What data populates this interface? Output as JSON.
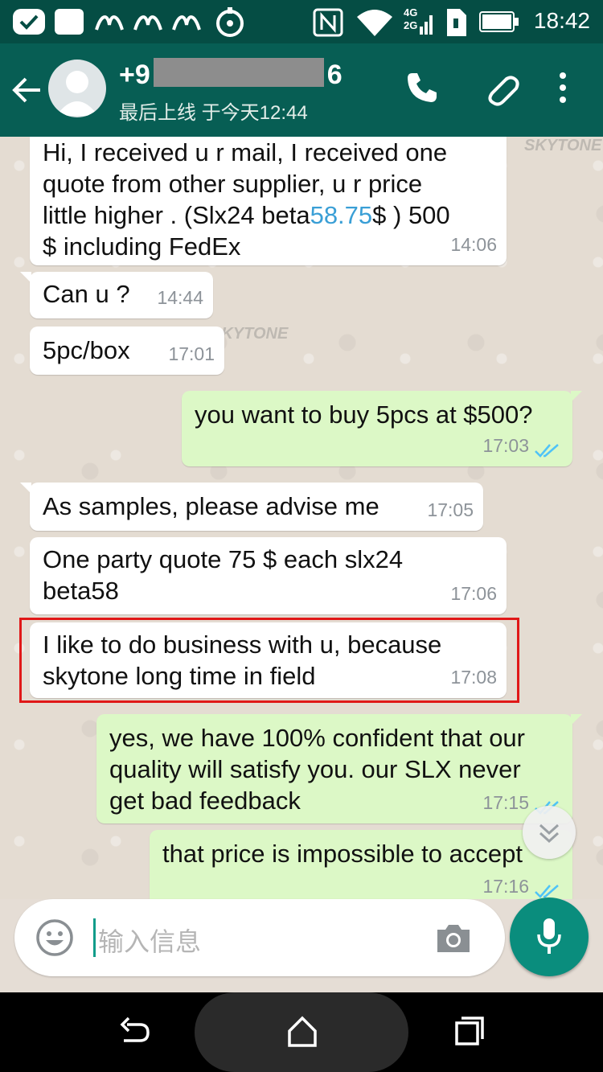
{
  "status_bar": {
    "time": "18:42",
    "network_labels": [
      "4G",
      "2G"
    ],
    "icons": [
      "check-notification-icon",
      "square-notification-icon",
      "wave-notification-icon",
      "wave-notification-icon",
      "wave-notification-icon",
      "sync-icon",
      "nfc-icon",
      "wifi-icon",
      "signal-icon",
      "sim-icon",
      "battery-icon"
    ]
  },
  "header": {
    "contact_prefix": "+9",
    "contact_suffix": "6",
    "last_seen": "最后上线 于今天12:44",
    "icons": [
      "back-arrow-icon",
      "avatar",
      "phone-icon",
      "paperclip-icon",
      "more-vert-icon"
    ]
  },
  "messages": [
    {
      "dir": "in",
      "text_a": "Hi, I received u r mail,  I received one\nquote from other supplier, u r price\nlittle higher . (Slx24 beta",
      "link": "58.75",
      "text_b": "$ ) 500\n$ including FedEx",
      "time": "14:06"
    },
    {
      "dir": "in",
      "text": "Can u ?",
      "time": "14:44"
    },
    {
      "dir": "in",
      "text": "5pc/box",
      "time": "17:01"
    },
    {
      "dir": "out",
      "text": "you want to buy 5pcs at $500?",
      "time": "17:03"
    },
    {
      "dir": "in",
      "text": "As samples, please advise me",
      "time": "17:05"
    },
    {
      "dir": "in",
      "text": "One party quote 75 $ each slx24\nbeta58",
      "time": "17:06"
    },
    {
      "dir": "in",
      "text": "I like to do business with u, because\nskytone long time in field",
      "time": "17:08"
    },
    {
      "dir": "out",
      "text": "yes, we have 100% confident that our\nquality will satisfy you. our SLX never\nget bad feedback",
      "time": "17:15"
    },
    {
      "dir": "out",
      "text": "that price is impossible to accept",
      "time": "17:16"
    }
  ],
  "watermark": "SKYTONE",
  "input": {
    "placeholder": "输入信息"
  },
  "colors": {
    "status_bar": "#054d44",
    "header": "#075e54",
    "outgoing_bubble": "#dcf8c6",
    "incoming_bubble": "#ffffff",
    "link": "#3a9fd6",
    "highlight_border": "#e01818",
    "mic_button": "#0a8d7d",
    "read_ticks": "#4fc3f7"
  }
}
